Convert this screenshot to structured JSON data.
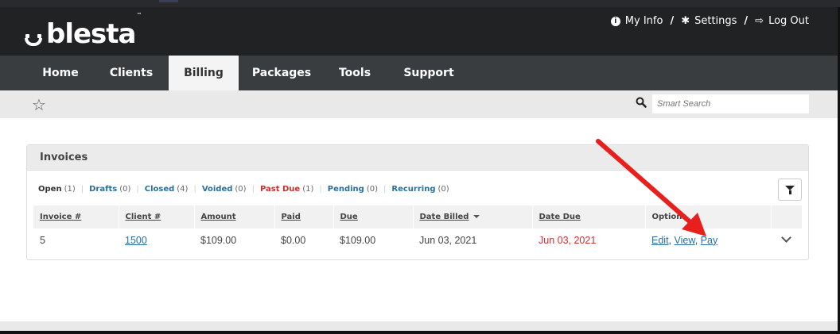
{
  "brand": {
    "logo_text": "blesta",
    "trademark": "™"
  },
  "toplinks": {
    "my_info": "My Info",
    "settings": "Settings",
    "logout": "Log Out",
    "separator": "/"
  },
  "nav": {
    "items": [
      {
        "label": "Home"
      },
      {
        "label": "Clients"
      },
      {
        "label": "Billing",
        "active": true
      },
      {
        "label": "Packages"
      },
      {
        "label": "Tools"
      },
      {
        "label": "Support"
      }
    ]
  },
  "search": {
    "placeholder": "Smart Search"
  },
  "panel": {
    "title": "Invoices",
    "tabs": [
      {
        "label": "Open",
        "count": "(1)"
      },
      {
        "label": "Drafts",
        "count": "(0)"
      },
      {
        "label": "Closed",
        "count": "(4)"
      },
      {
        "label": "Voided",
        "count": "(0)"
      },
      {
        "label": "Past Due",
        "count": "(1)"
      },
      {
        "label": "Pending",
        "count": "(0)"
      },
      {
        "label": "Recurring",
        "count": "(0)"
      }
    ],
    "table": {
      "headers": [
        "Invoice #",
        "Client #",
        "Amount",
        "Paid",
        "Due",
        "Date Billed",
        "Date Due",
        "Options"
      ],
      "rows": [
        {
          "invoice": "5",
          "client": "1500",
          "amount": "$109.00",
          "paid": "$0.00",
          "due": "$109.00",
          "date_billed": "Jun 03, 2021",
          "date_due": "Jun 03, 2021",
          "options": {
            "edit": "Edit",
            "view": "View",
            "pay": "Pay",
            "sep": ","
          }
        }
      ]
    }
  },
  "colors": {
    "header_bg": "#202223",
    "nav_bg": "#3a3d40",
    "link": "#2a6f9c",
    "past_due": "#c9302c",
    "annotation_arrow": "#e8201d"
  },
  "icons": {
    "info": "info-circle-icon",
    "settings": "gear-icon",
    "logout": "sign-out-icon",
    "favorite": "star-outline-icon",
    "search": "search-icon",
    "filter": "filter-icon",
    "sort": "caret-down-icon",
    "expand": "chevron-down-icon"
  }
}
